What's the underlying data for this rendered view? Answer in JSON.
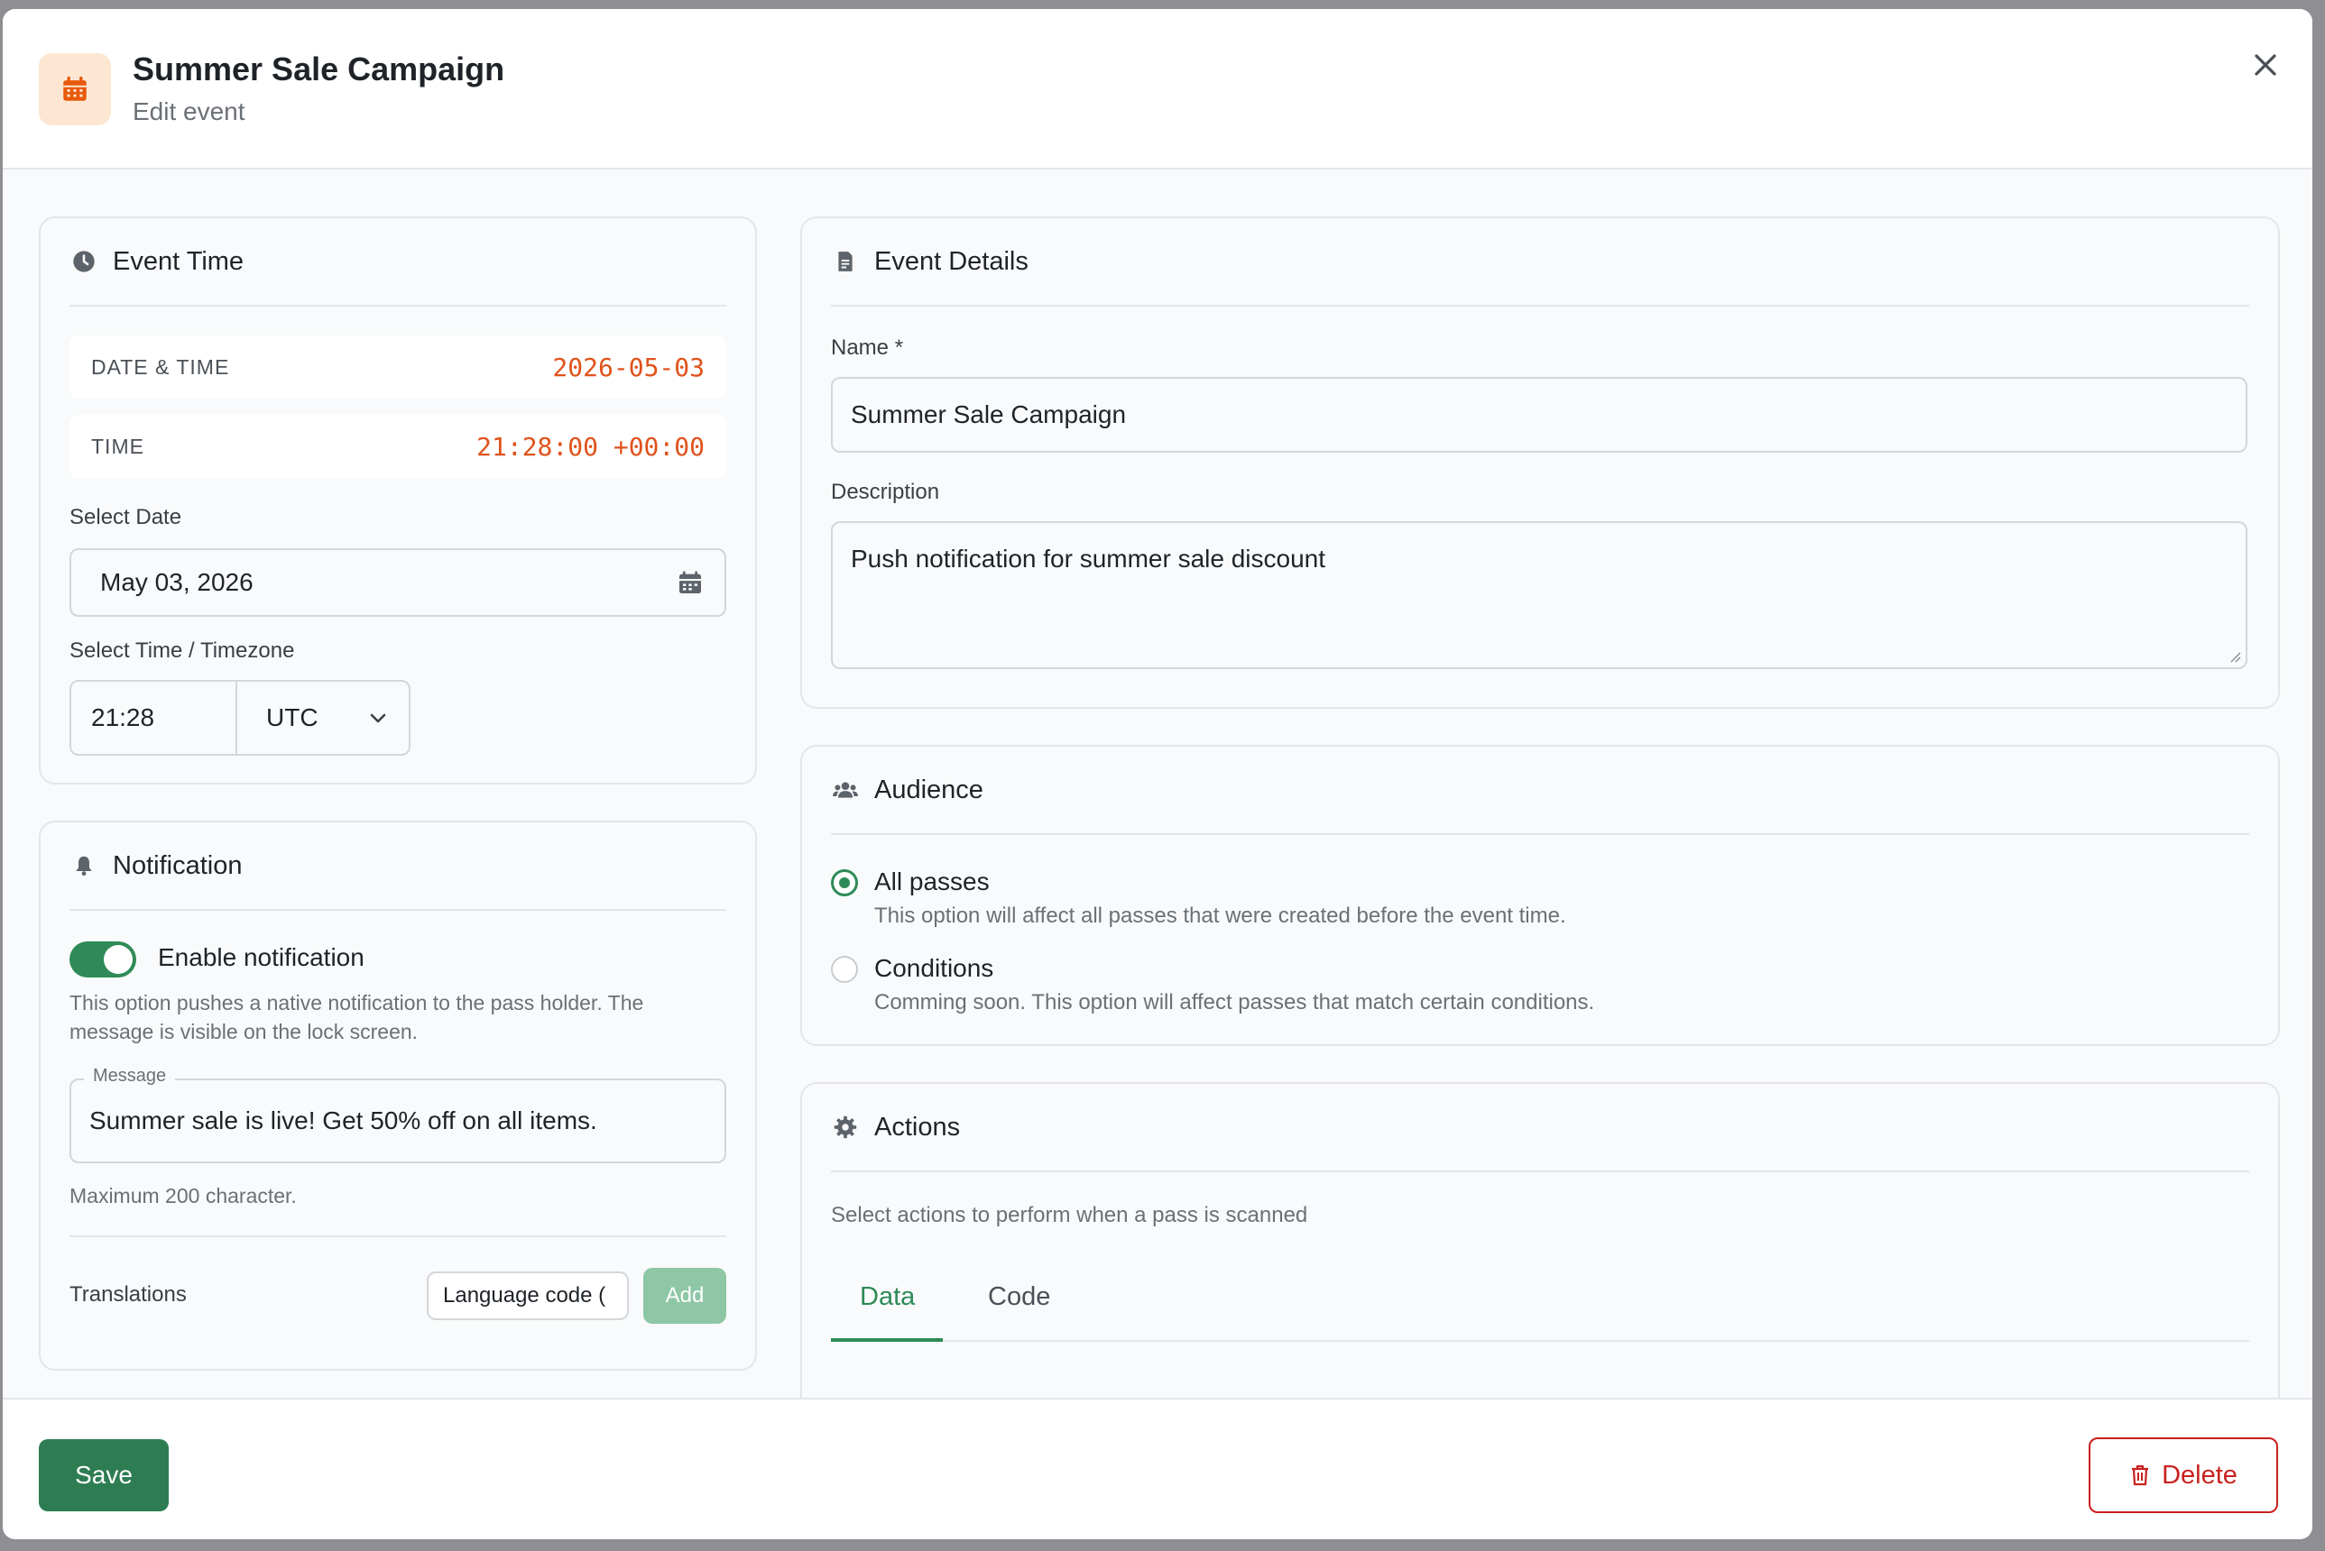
{
  "header": {
    "title": "Summer Sale Campaign",
    "subtitle": "Edit event",
    "icon": "calendar-icon"
  },
  "event_time": {
    "heading": "Event Time",
    "datetime_label": "DATE & TIME",
    "datetime_value": "2026-05-03",
    "time_label": "TIME",
    "time_value": "21:28:00 +00:00",
    "select_date_label": "Select Date",
    "date_value": "May 03, 2026",
    "select_time_label": "Select Time / Timezone",
    "time_input": "21:28",
    "timezone": "UTC"
  },
  "notification": {
    "heading": "Notification",
    "enable_label": "Enable notification",
    "enabled": true,
    "helper_line1": "This option pushes a native notification to the pass holder. The",
    "helper_line2": "message is visible on the lock screen.",
    "message_label": "Message",
    "message_value": "Summer sale is live! Get 50% off on all items.",
    "max_hint": "Maximum 200 character.",
    "translations_label": "Translations",
    "language_placeholder": "Language code (",
    "add_label": "Add"
  },
  "event_details": {
    "heading": "Event Details",
    "name_label": "Name *",
    "name_value": "Summer Sale Campaign",
    "description_label": "Description",
    "description_value": "Push notification for summer sale discount"
  },
  "audience": {
    "heading": "Audience",
    "options": [
      {
        "title": "All passes",
        "desc": "This option will affect all passes that were created before the event time.",
        "selected": true
      },
      {
        "title": "Conditions",
        "desc": "Comming soon. This option will affect passes that match certain conditions.",
        "selected": false
      }
    ]
  },
  "actions": {
    "heading": "Actions",
    "description": "Select actions to perform when a pass is scanned",
    "tabs": [
      "Data",
      "Code"
    ],
    "active_tab": "Data"
  },
  "footer": {
    "save_label": "Save",
    "delete_label": "Delete"
  },
  "colors": {
    "accent": "#2e8b57",
    "danger": "#c8211e",
    "highlight": "#e0521b"
  }
}
